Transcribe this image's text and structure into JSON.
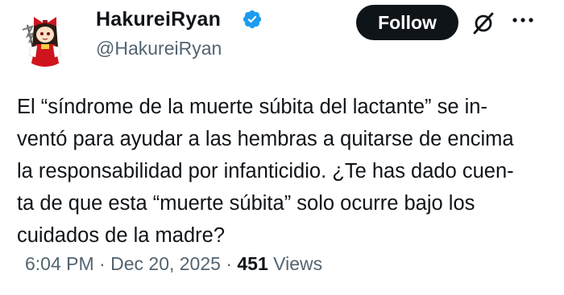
{
  "author": {
    "display_name": "HakureiRyan",
    "handle": "@HakureiRyan",
    "verified_icon": "verified-badge-icon",
    "verified_color": "#1d9bf0"
  },
  "actions": {
    "follow_label": "Follow",
    "grok_icon": "grok-icon",
    "more_icon": "more-options-icon"
  },
  "tweet": {
    "lines": [
      "El “síndrome de la muerte súbita del lactante” se in-",
      "ventó para ayudar a las hembras a quitarse de encima",
      "la responsabilidad por infanticidio. ¿Te has dado cuen-",
      "ta de que esta “muerte súbita” solo ocurre bajo los",
      "cuidados de la madre?"
    ]
  },
  "meta": {
    "time": "6:04 PM",
    "separator": "·",
    "date": "Dec 20, 2025",
    "views_count": "451",
    "views_label": "Views"
  }
}
